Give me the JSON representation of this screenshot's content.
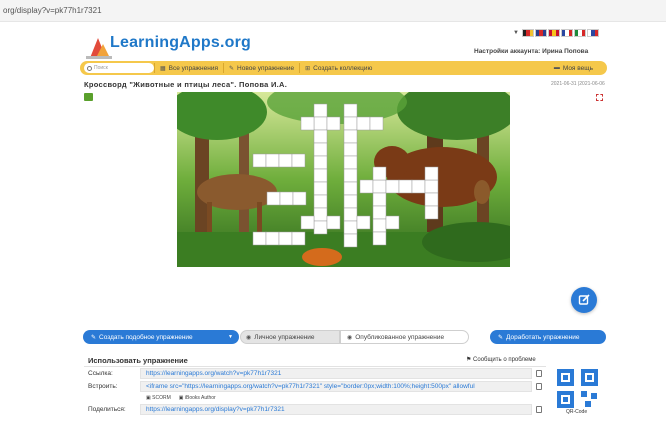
{
  "browser": {
    "url": "org/display?v=pk77h1r7321"
  },
  "header": {
    "logo_text": "LearningApps.org",
    "account_text": "Настройки аккаунта: Ирина Попова",
    "flags": [
      {
        "name": "de-flag",
        "colors": [
          "#222222",
          "#d62828",
          "#f2c230"
        ]
      },
      {
        "name": "gb-flag",
        "colors": [
          "#2b3f8f",
          "#d62828",
          "#2b3f8f"
        ]
      },
      {
        "name": "es-flag",
        "colors": [
          "#c8102e",
          "#f6c31b",
          "#c8102e"
        ]
      },
      {
        "name": "fr-flag",
        "colors": [
          "#2b47a0",
          "#ffffff",
          "#d62828"
        ]
      },
      {
        "name": "it-flag",
        "colors": [
          "#1f8a3a",
          "#ffffff",
          "#d62828"
        ]
      },
      {
        "name": "ru-flag",
        "colors": [
          "#ffffff",
          "#2b47a0",
          "#d62828"
        ]
      }
    ]
  },
  "nav": {
    "search_placeholder": "Поиск",
    "all_exercises": "Все упражнения",
    "new_exercise": "Новое упражнение",
    "create_collection": "Создать коллекцию",
    "my_stuff": "Моя вещь"
  },
  "exercise": {
    "title": "Кроссворд \"Животные и птицы леса\". Попова И.А.",
    "date": "2021-06-31 |2021-06-06"
  },
  "actions": {
    "create_similar": "Создать подобное упражнение",
    "private_exercise": "Личное упражнение",
    "published_exercise": "Опубликованное упражнение",
    "improve_exercise": "Доработать упражнение"
  },
  "use": {
    "title": "Использовать упражнение",
    "report": "Сообщить о проблеме",
    "link_label": "Ссылка:",
    "link_value": "https://learningapps.org/watch?v=pk77h1r7321",
    "embed_label": "Встроить:",
    "embed_value": "<iframe src=\"https://learningapps.org/watch?v=pk77h1r7321\" style=\"border:0px;width:100%;height:500px\" allowful",
    "scorm": "SCORM",
    "ibooks": "iBooks Author",
    "share_label": "Поделиться:",
    "share_value": "https://learningapps.org/display?v=pk77h1r7321",
    "qr_label": "QR-Code"
  },
  "colors": {
    "accent_blue": "#2a7ad6",
    "nav_yellow": "#f5c84b",
    "logo_blue": "#1f78c8"
  }
}
